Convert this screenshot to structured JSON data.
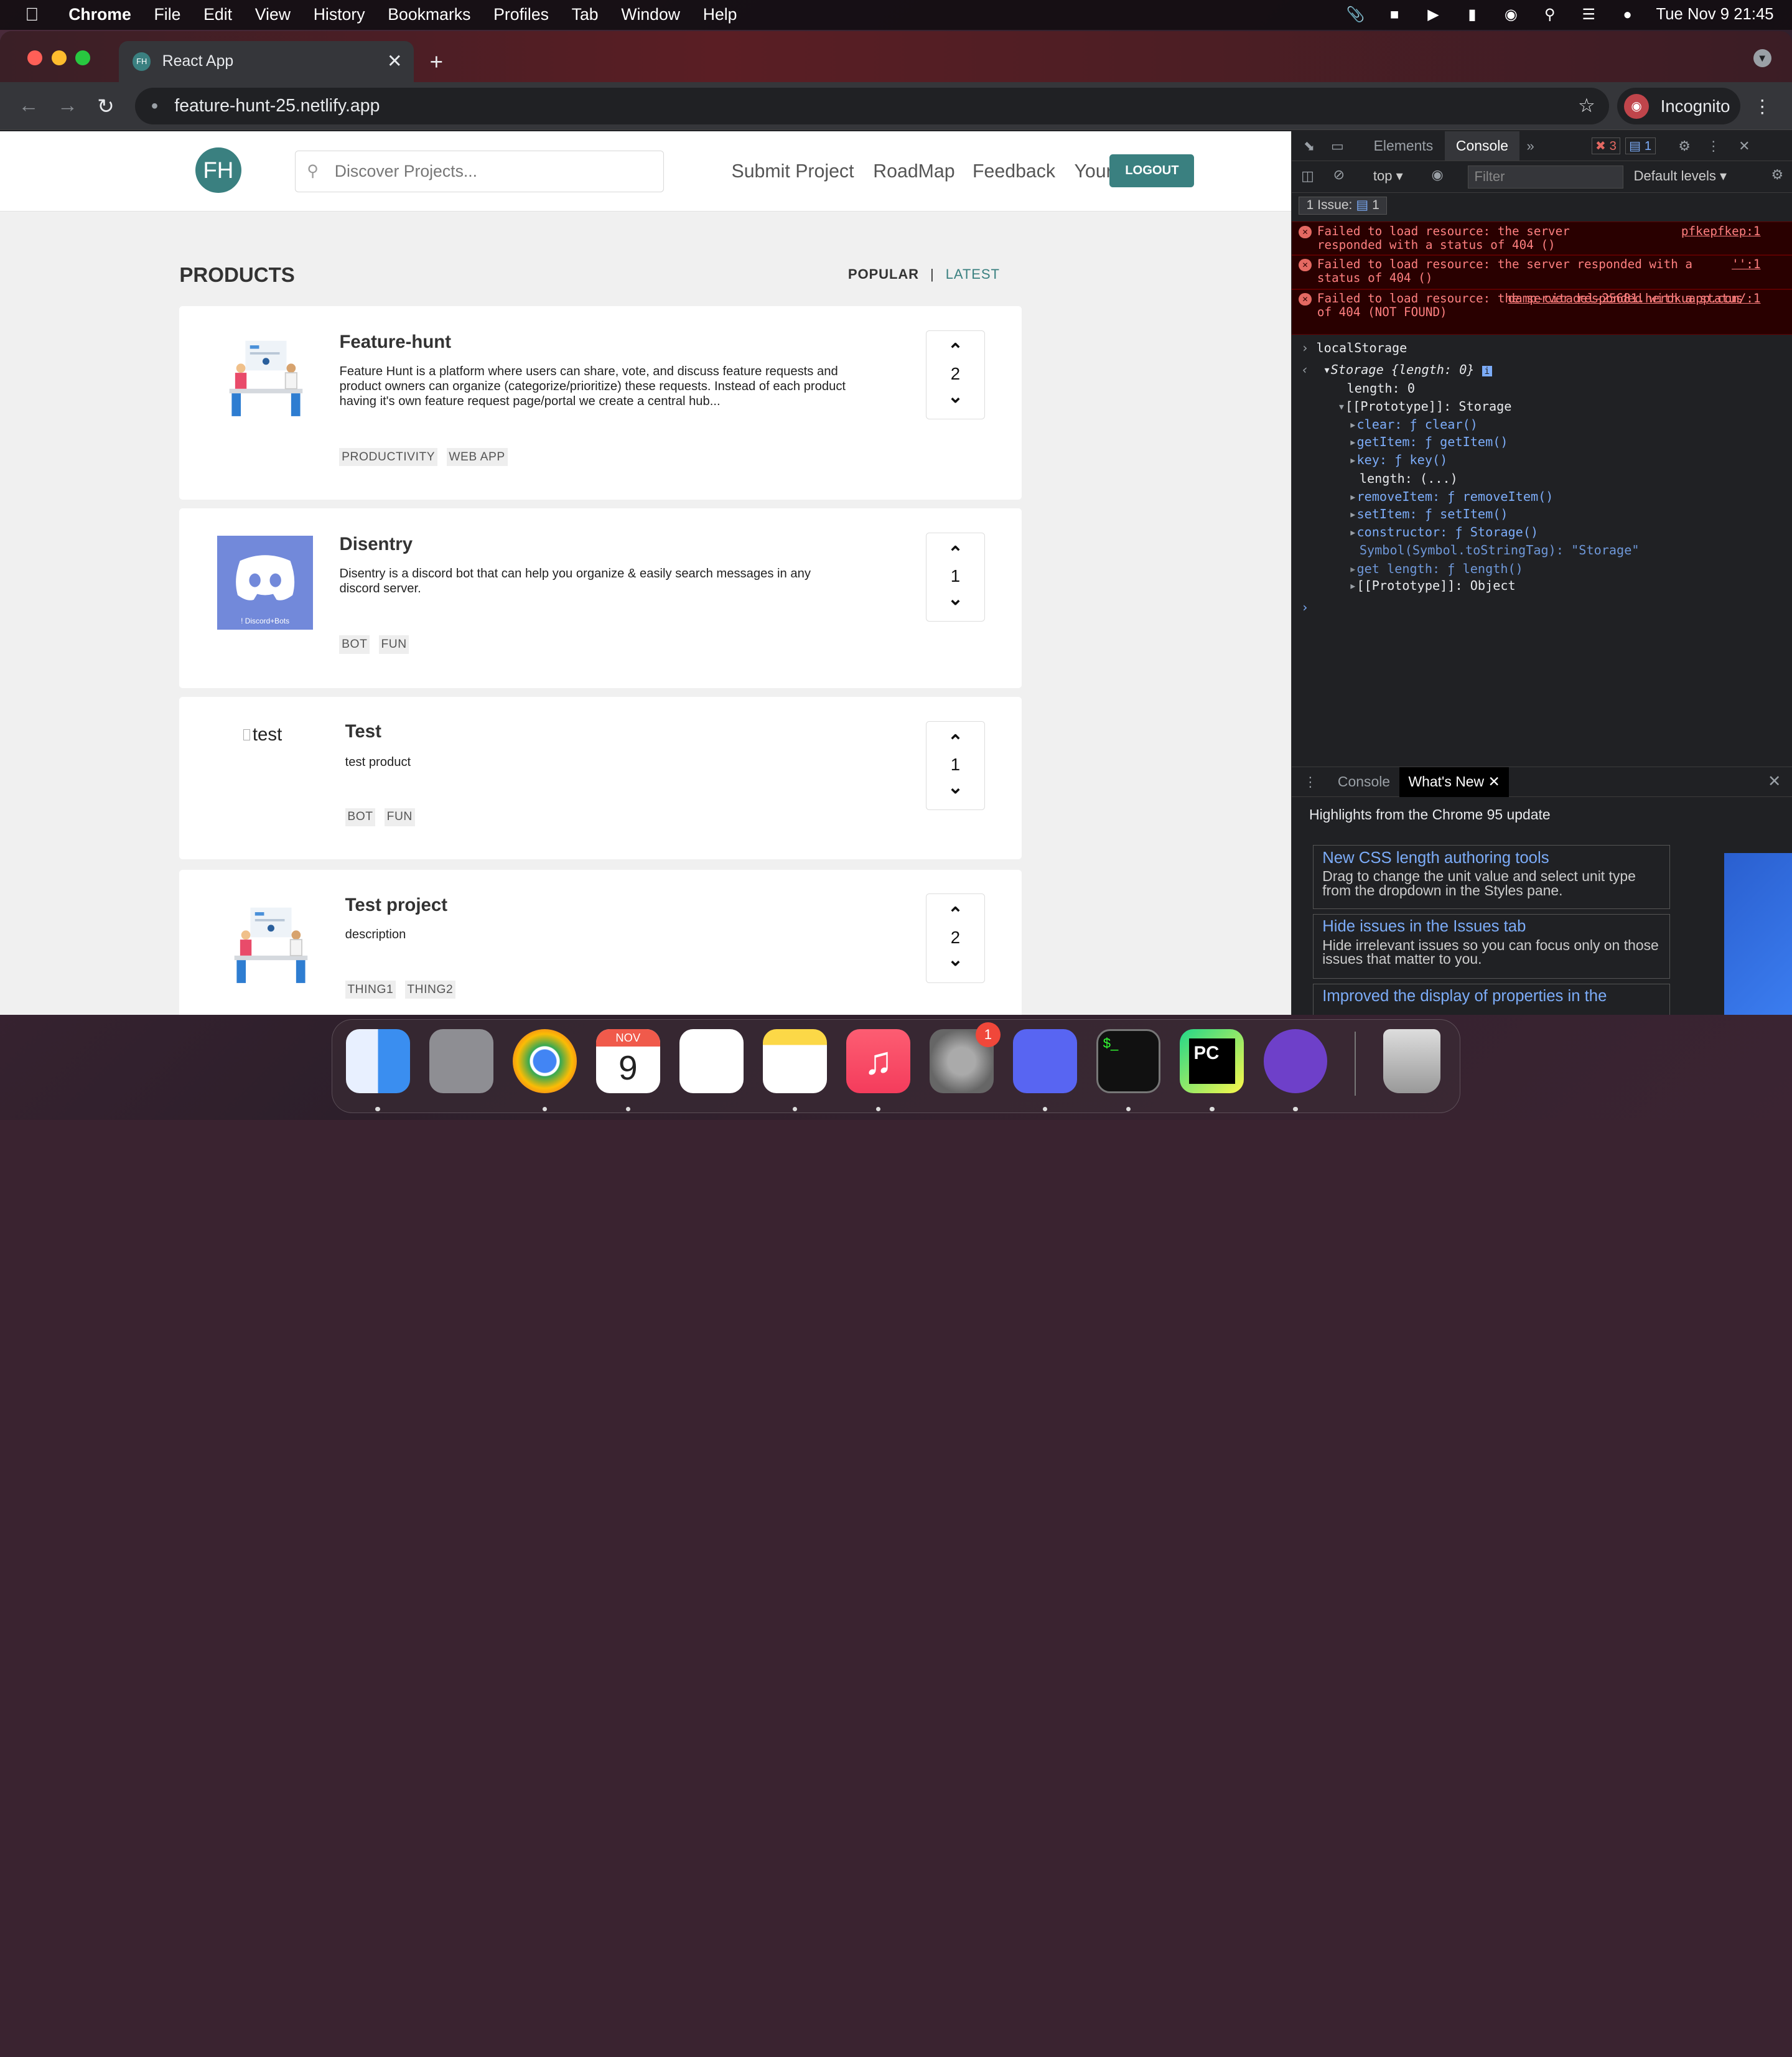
{
  "menubar": {
    "app": "Chrome",
    "items": [
      "File",
      "Edit",
      "View",
      "History",
      "Bookmarks",
      "Profiles",
      "Tab",
      "Window",
      "Help"
    ],
    "clock": "Tue Nov 9  21:45"
  },
  "browser": {
    "tab_title": "React App",
    "favicon": "FH",
    "url": "feature-hunt-25.netlify.app",
    "incognito_label": "Incognito"
  },
  "site": {
    "logo": "FH",
    "search_placeholder": "Discover Projects...",
    "nav": [
      "Submit Project",
      "RoadMap",
      "Feedback",
      "Your"
    ],
    "logout": "LOGOUT",
    "heading": "PRODUCTS",
    "sort": {
      "popular": "POPULAR",
      "sep": "|",
      "latest": "LATEST"
    },
    "products": [
      {
        "title": "Feature-hunt",
        "description": "Feature Hunt is a platform where users can share, vote, and discuss feature requests and product owners can organize (categorize/prioritize) these requests. Instead of each product having it's own feature request page/portal we create a central hub...",
        "tags": [
          "PRODUCTIVITY",
          "WEB APP"
        ],
        "votes": "2"
      },
      {
        "title": "Disentry",
        "description": "Disentry is a discord bot that can help you organize & easily search messages in any discord server.",
        "tags": [
          "BOT",
          "FUN"
        ],
        "votes": "1",
        "image_caption": "! Discord+Bots"
      },
      {
        "title": "Test",
        "description": "test product",
        "tags": [
          "BOT",
          "FUN"
        ],
        "votes": "1",
        "image_alt": "test"
      },
      {
        "title": "Test project",
        "description": "description",
        "tags": [
          "THING1",
          "THING2"
        ],
        "votes": "2"
      }
    ]
  },
  "devtools": {
    "tabs": [
      "Elements",
      "Console"
    ],
    "error_count": "3",
    "message_count": "1",
    "context": "top",
    "filter_placeholder": "Filter",
    "levels": "Default levels",
    "issues": "1 Issue:",
    "issues_count": "1",
    "errors": [
      {
        "text": "Failed to load resource: the server responded with a status of 404 ()",
        "source": "pfkepfkep:1"
      },
      {
        "text": "Failed to load resource: the server responded with a status of 404 ()",
        "source": "'':1"
      },
      {
        "text": "Failed to load resource: the server responded with a status of 404 (NOT FOUND)",
        "source": "damp-citadel-25681.herokuapp.com/:1"
      }
    ],
    "input": "localStorage",
    "storage_line": "Storage {length: 0}",
    "tree": [
      "length: 0",
      "[[Prototype]]: Storage",
      "clear: ƒ clear()",
      "getItem: ƒ getItem()",
      "key: ƒ key()",
      "length: (...)",
      "removeItem: ƒ removeItem()",
      "setItem: ƒ setItem()",
      "constructor: ƒ Storage()",
      "Symbol(Symbol.toStringTag): \"Storage\"",
      "get length: ƒ length()",
      "[[Prototype]]: Object"
    ],
    "drawer": {
      "tabs": [
        "Console",
        "What's New"
      ],
      "headline": "Highlights from the Chrome 95 update",
      "cards": [
        {
          "title": "New CSS length authoring tools",
          "desc": "Drag to change the unit value and select unit type from the dropdown in the Styles pane."
        },
        {
          "title": "Hide issues in the Issues tab",
          "desc": "Hide irrelevant issues so you can focus only on those issues that matter to you."
        },
        {
          "title": "Improved the display of properties in the",
          "desc": ""
        }
      ]
    }
  },
  "dock": {
    "calendar_month": "NOV",
    "calendar_day": "9",
    "badge": "1"
  }
}
